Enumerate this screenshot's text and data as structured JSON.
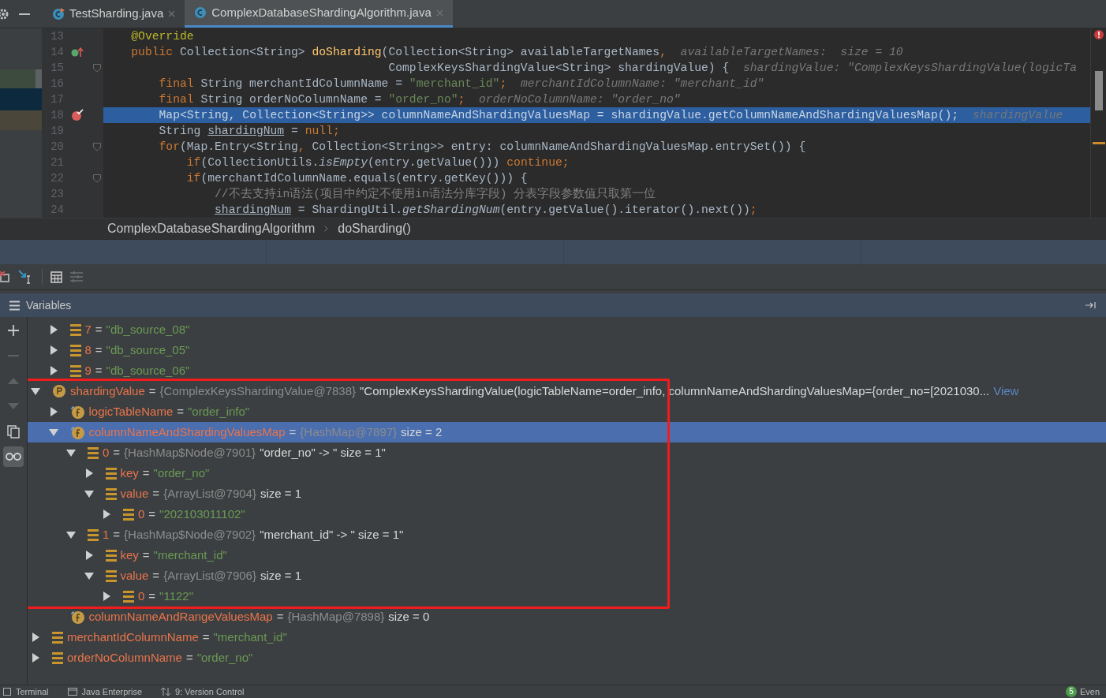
{
  "tabs": [
    {
      "label": "TestSharding.java",
      "kind": "runnable",
      "selected": false
    },
    {
      "label": "ComplexDatabaseShardingAlgorithm.java",
      "kind": "class",
      "selected": true
    }
  ],
  "editor": {
    "lines": [
      {
        "number": "13",
        "kind": "plain",
        "fold": false,
        "selected": false,
        "tokens": [
          {
            "kind": "annotation",
            "text": "    @Override"
          }
        ]
      },
      {
        "number": "14",
        "kind": "override",
        "fold": false,
        "selected": false,
        "tokens": [
          {
            "kind": "kw",
            "text": "    public "
          },
          {
            "kind": "plain",
            "text": "Collection<String> "
          },
          {
            "kind": "method",
            "text": "doSharding"
          },
          {
            "kind": "plain",
            "text": "(Collection<String> availableTargetNames"
          },
          {
            "kind": "kw",
            "text": ","
          },
          {
            "kind": "hint",
            "text": "  availableTargetNames:  size = 10"
          }
        ]
      },
      {
        "number": "15",
        "kind": "plain",
        "fold": true,
        "selected": false,
        "tokens": [
          {
            "kind": "plain",
            "text": "                                         ComplexKeysShardingValue<String> shardingValue) {"
          },
          {
            "kind": "hint",
            "text": "  shardingValue: \"ComplexKeysShardingValue(logicTa"
          }
        ]
      },
      {
        "number": "16",
        "kind": "plain",
        "fold": false,
        "selected": false,
        "tokens": [
          {
            "kind": "kw",
            "text": "        final "
          },
          {
            "kind": "plain",
            "text": "String merchantIdColumnName = "
          },
          {
            "kind": "str",
            "text": "\"merchant_id\""
          },
          {
            "kind": "kw",
            "text": ";"
          },
          {
            "kind": "hint",
            "text": "  merchantIdColumnName: \"merchant_id\""
          }
        ]
      },
      {
        "number": "17",
        "kind": "plain",
        "fold": false,
        "selected": false,
        "tokens": [
          {
            "kind": "kw",
            "text": "        final "
          },
          {
            "kind": "plain",
            "text": "String orderNoColumnName = "
          },
          {
            "kind": "str",
            "text": "\"order_no\""
          },
          {
            "kind": "kw",
            "text": ";"
          },
          {
            "kind": "hint",
            "text": "  orderNoColumnName: \"order_no\""
          }
        ]
      },
      {
        "number": "18",
        "kind": "breakpoint",
        "fold": false,
        "selected": true,
        "tokens": [
          {
            "kind": "plain",
            "text": "        Map<String"
          },
          {
            "kind": "kw",
            "text": ","
          },
          {
            "kind": "plain",
            "text": " Collection<String>> columnNameAndShardingValuesMap = shardingValue.getColumnNameAndShardingValuesMap()"
          },
          {
            "kind": "kw",
            "text": ";"
          },
          {
            "kind": "hint",
            "text": "  shardingValue"
          }
        ]
      },
      {
        "number": "19",
        "kind": "plain",
        "fold": false,
        "selected": false,
        "tokens": [
          {
            "kind": "plain",
            "text": "        String "
          },
          {
            "kind": "var",
            "text": "shardingNum"
          },
          {
            "kind": "plain",
            "text": " = "
          },
          {
            "kind": "kw",
            "text": "null;"
          }
        ]
      },
      {
        "number": "20",
        "kind": "plain",
        "fold": true,
        "selected": false,
        "tokens": [
          {
            "kind": "kw",
            "text": "        for"
          },
          {
            "kind": "plain",
            "text": "(Map.Entry<String"
          },
          {
            "kind": "kw",
            "text": ","
          },
          {
            "kind": "plain",
            "text": " Collection<String>> entry: columnNameAndShardingValuesMap.entrySet()) {"
          }
        ]
      },
      {
        "number": "21",
        "kind": "plain",
        "fold": false,
        "selected": false,
        "tokens": [
          {
            "kind": "kw",
            "text": "            if"
          },
          {
            "kind": "plain",
            "text": "(CollectionUtils."
          },
          {
            "kind": "italic",
            "text": "isEmpty"
          },
          {
            "kind": "plain",
            "text": "(entry.getValue())) "
          },
          {
            "kind": "kw",
            "text": "continue;"
          }
        ]
      },
      {
        "number": "22",
        "kind": "plain",
        "fold": true,
        "selected": false,
        "tokens": [
          {
            "kind": "kw",
            "text": "            if"
          },
          {
            "kind": "plain",
            "text": "(merchantIdColumnName.equals(entry.getKey())) {"
          }
        ]
      },
      {
        "number": "23",
        "kind": "plain",
        "fold": false,
        "selected": false,
        "tokens": [
          {
            "kind": "comment",
            "text": "                //不去支持in语法(项目中约定不使用in语法分库字段) 分表字段参数值只取第一位"
          }
        ]
      },
      {
        "number": "24",
        "kind": "plain",
        "fold": false,
        "selected": false,
        "tokens": [
          {
            "kind": "var",
            "text": "                shardingNum"
          },
          {
            "kind": "plain",
            "text": " = ShardingUtil."
          },
          {
            "kind": "italic",
            "text": "getShardingNum"
          },
          {
            "kind": "plain",
            "text": "(entry.getValue().iterator().next())"
          },
          {
            "kind": "kw",
            "text": ";"
          }
        ]
      }
    ]
  },
  "breadcrumb": [
    "ComplexDatabaseShardingAlgorithm",
    "doSharding()"
  ],
  "variables": {
    "title": "Variables",
    "partial_children": [
      {
        "name": "7",
        "kind": "entry",
        "sign": "=",
        "string_value": "\"db_source_08\"",
        "expandable": true,
        "expanded": false,
        "selected": false
      },
      {
        "name": "8",
        "kind": "entry",
        "sign": "=",
        "string_value": "\"db_source_05\"",
        "expandable": true,
        "expanded": false,
        "selected": false
      },
      {
        "name": "9",
        "kind": "entry",
        "sign": "=",
        "string_value": "\"db_source_06\"",
        "expandable": true,
        "expanded": false,
        "selected": false
      }
    ],
    "items": [
      {
        "name": "shardingValue",
        "kind": "parameter",
        "sign": "=",
        "type": "{ComplexKeysShardingValue@7838}",
        "value": "\"ComplexKeysShardingValue(logicTableName=order_info, columnNameAndShardingValuesMap={order_no=[2021030...",
        "link": "View",
        "expandable": true,
        "expanded": true,
        "selected": false,
        "children": [
          {
            "name": "logicTableName",
            "kind": "field",
            "sign": "=",
            "string_value": "\"order_info\"",
            "expandable": true,
            "expanded": false,
            "selected": false
          },
          {
            "name": "columnNameAndShardingValuesMap",
            "kind": "field",
            "sign": "=",
            "type": "{HashMap@7897}",
            "value": "size = 2",
            "expandable": true,
            "expanded": true,
            "selected": true,
            "children": [
              {
                "name": "0",
                "kind": "entry",
                "sign": "=",
                "type": "{HashMap$Node@7901}",
                "value": "\"order_no\" -> \" size = 1\"",
                "expandable": true,
                "expanded": true,
                "selected": false,
                "children": [
                  {
                    "name": "key",
                    "kind": "entry",
                    "sign": "=",
                    "string_value": "\"order_no\"",
                    "expandable": true,
                    "expanded": false,
                    "selected": false
                  },
                  {
                    "name": "value",
                    "kind": "entry",
                    "sign": "=",
                    "type": "{ArrayList@7904}",
                    "value": "size = 1",
                    "expandable": true,
                    "expanded": true,
                    "selected": false,
                    "children": [
                      {
                        "name": "0",
                        "kind": "entry",
                        "sign": "=",
                        "string_value": "\"202103011102\"",
                        "expandable": true,
                        "expanded": false,
                        "selected": false
                      }
                    ]
                  }
                ]
              },
              {
                "name": "1",
                "kind": "entry",
                "sign": "=",
                "type": "{HashMap$Node@7902}",
                "value": "\"merchant_id\" -> \" size = 1\"",
                "expandable": true,
                "expanded": true,
                "selected": false,
                "children": [
                  {
                    "name": "key",
                    "kind": "entry",
                    "sign": "=",
                    "string_value": "\"merchant_id\"",
                    "expandable": true,
                    "expanded": false,
                    "selected": false
                  },
                  {
                    "name": "value",
                    "kind": "entry",
                    "sign": "=",
                    "type": "{ArrayList@7906}",
                    "value": "size = 1",
                    "expandable": true,
                    "expanded": true,
                    "selected": false,
                    "children": [
                      {
                        "name": "0",
                        "kind": "entry",
                        "sign": "=",
                        "string_value": "\"1122\"",
                        "expandable": true,
                        "expanded": false,
                        "selected": false
                      }
                    ]
                  }
                ]
              }
            ]
          },
          {
            "name": "columnNameAndRangeValuesMap",
            "kind": "field",
            "sign": "=",
            "type": "{HashMap@7898}",
            "value": "size = 0",
            "expandable": false,
            "selected": false
          }
        ]
      },
      {
        "name": "merchantIdColumnName",
        "kind": "entry",
        "sign": "=",
        "string_value": "\"merchant_id\"",
        "expandable": true,
        "expanded": false,
        "selected": false
      },
      {
        "name": "orderNoColumnName",
        "kind": "entry",
        "sign": "=",
        "string_value": "\"order_no\"",
        "expandable": true,
        "expanded": false,
        "selected": false
      }
    ]
  },
  "bottom_bar": {
    "tools": [
      {
        "label": "Terminal",
        "kind": "terminal"
      },
      {
        "label": "Java Enterprise",
        "kind": "enterprise"
      },
      {
        "label": "9: Version Control",
        "kind": "vcs"
      }
    ],
    "event_count": "5",
    "event_label": "Even"
  }
}
